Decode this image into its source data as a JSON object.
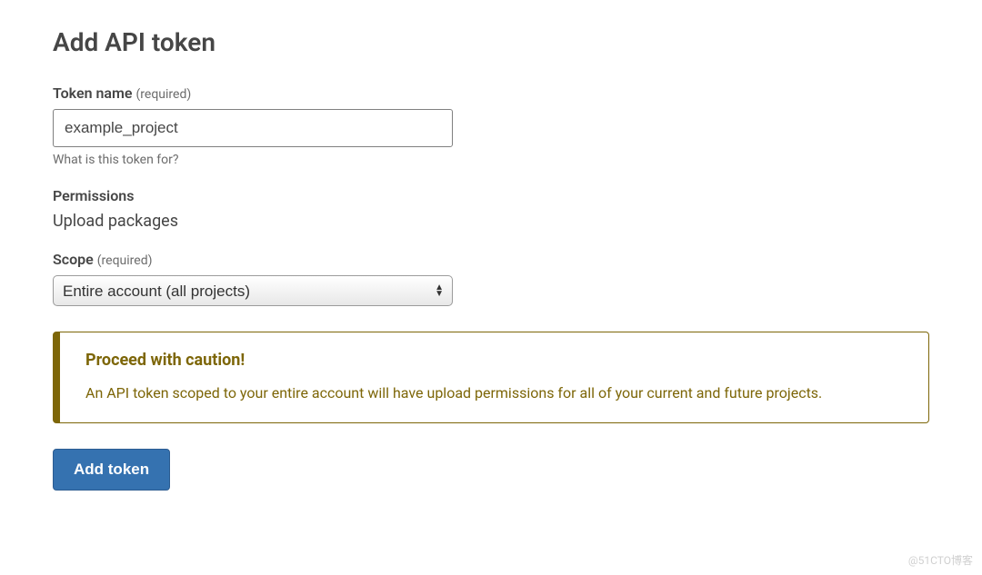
{
  "page": {
    "title": "Add API token"
  },
  "token_name": {
    "label": "Token name",
    "required_hint": "(required)",
    "value": "example_project",
    "help": "What is this token for?"
  },
  "permissions": {
    "label": "Permissions",
    "value": "Upload packages"
  },
  "scope": {
    "label": "Scope",
    "required_hint": "(required)",
    "selected": "Entire account (all projects)"
  },
  "callout": {
    "title": "Proceed with caution!",
    "body": "An API token scoped to your entire account will have upload permissions for all of your current and future projects."
  },
  "actions": {
    "submit_label": "Add token"
  },
  "watermark": "@51CTO博客"
}
